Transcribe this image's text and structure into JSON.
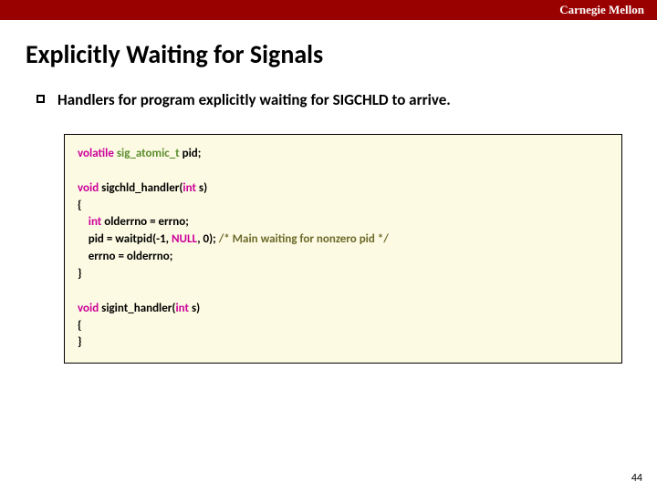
{
  "header": {
    "brand": "Carnegie Mellon"
  },
  "title": "Explicitly Waiting for Signals",
  "bullet": "Handlers for program explicitly waiting for SIGCHLD to arrive.",
  "code": {
    "kw_volatile": "volatile",
    "typ_sig": "sig_atomic_t",
    "ident_pid": " pid;",
    "kw_void1": "void",
    "fn1": " sigchld_handler(",
    "kw_int1": "int",
    "param1": " s)",
    "open1": "{",
    "kw_int2": "    int",
    "line_olderr": " olderrno = errno;",
    "line_pid_pre": "    pid = waitpid(-1, ",
    "kw_null": "NULL",
    "line_pid_post": ", 0); ",
    "com_main": "/* Main waiting for nonzero pid */",
    "line_errno": "    errno = olderrno;",
    "close1": "}",
    "kw_void2": "void",
    "fn2": " sigint_handler(",
    "kw_int3": "int",
    "param2": " s)",
    "open2": "{",
    "close2": "}"
  },
  "pagenum": "44"
}
